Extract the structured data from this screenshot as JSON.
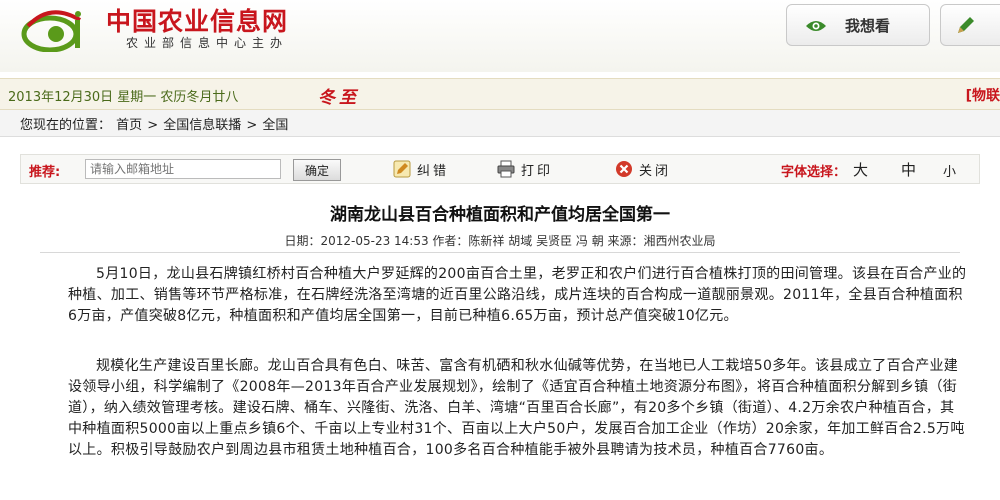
{
  "header": {
    "site_title": "中国农业信息网",
    "site_subtitle": "农业部信息中心主办",
    "want_label": "我想看",
    "write_label": ""
  },
  "dateline": {
    "date": "2013年12月30日  星期一  农历冬月廿八",
    "solar_term": "冬至",
    "right_text": "[物联"
  },
  "breadcrumb": {
    "prefix": "您现在的位置：",
    "items": [
      "首页",
      "全国信息联播",
      "全国"
    ],
    "sep": ">"
  },
  "toolbar": {
    "recommend_label": "推荐:",
    "email_placeholder": "请输入邮箱地址",
    "confirm_label": "确定",
    "correct_label": "纠错",
    "print_label": "打印",
    "close_label": "关闭",
    "font_select_label": "字体选择：",
    "font_big": "大",
    "font_mid": "中",
    "font_small": "小"
  },
  "article": {
    "title": "湖南龙山县百合种植面积和产值均居全国第一",
    "meta": "日期：2012-05-23 14:53  作者：陈新祥  胡域  吴贤臣  冯  朝  来源：湘西州农业局",
    "paragraphs": [
      "5月10日，龙山县石牌镇红桥村百合种植大户罗延辉的200亩百合土里，老罗正和农户们进行百合植株打顶的田间管理。该县在百合产业的种植、加工、销售等环节严格标准，在石牌经洗洛至湾塘的近百里公路沿线，成片连块的百合构成一道靓丽景观。2011年，全县百合种植面积6万亩，产值突破8亿元，种植面积和产值均居全国第一，目前已种植6.65万亩，预计总产值突破10亿元。",
      "规模化生产建设百里长廊。龙山百合具有色白、味苦、富含有机硒和秋水仙碱等优势，在当地已人工栽培50多年。该县成立了百合产业建设领导小组，科学编制了《2008年—2013年百合产业发展规划》，绘制了《适宜百合种植土地资源分布图》，将百合种植面积分解到乡镇（街道），纳入绩效管理考核。建设石牌、桶车、兴隆街、洗洛、白羊、湾塘“百里百合长廊”，有20多个乡镇（街道）、4.2万余农户种植百合，其中种植面积5000亩以上重点乡镇6个、千亩以上专业村31个、百亩以上大户50户，发展百合加工企业（作坊）20余家，年加工鲜百合2.5万吨以上。积极引导鼓励农户到周边县市租赁土地种植百合，100多名百合种植能手被外县聘请为技术员，种植百合7760亩。"
    ]
  },
  "colors": {
    "brand_red": "#c8161d",
    "logo_green": "#5a9a1a",
    "date_green": "#4a6a1a"
  }
}
